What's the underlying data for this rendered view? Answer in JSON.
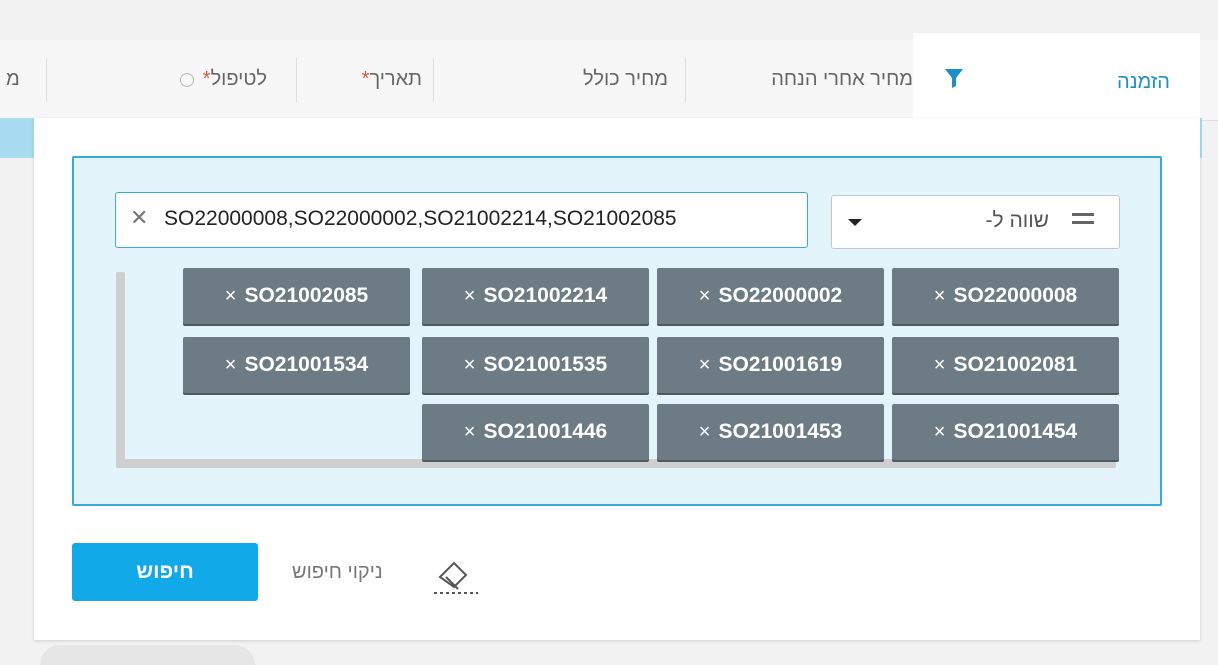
{
  "table": {
    "columns": [
      {
        "label": "מ"
      },
      {
        "label": "לטיפול"
      },
      {
        "label": "תאריך"
      },
      {
        "label": "מחיר כולל"
      },
      {
        "label": "מחיר אחרי הנחה"
      }
    ],
    "active_column": {
      "label": "הזמנה"
    }
  },
  "filter": {
    "operator": {
      "label": "שווה ל-"
    },
    "input": {
      "value": "SO22000008,SO22000002,SO21002214,SO21002085"
    },
    "tags": [
      "SO22000008",
      "SO22000002",
      "SO21002214",
      "SO21002085",
      "SO21002081",
      "SO21001619",
      "SO21001535",
      "SO21001534",
      "SO21001454",
      "SO21001453",
      "SO21001446"
    ],
    "tag_remove_symbol": "×"
  },
  "actions": {
    "search_label": "חיפוש",
    "clear_label": "ניקוי חיפוש"
  },
  "colors": {
    "accent": "#12a9e8",
    "tag_bg": "#6c7b84",
    "filter_bg": "#e4f4fb",
    "filter_border": "#3aa8d8",
    "required_star": "#e0533b"
  }
}
